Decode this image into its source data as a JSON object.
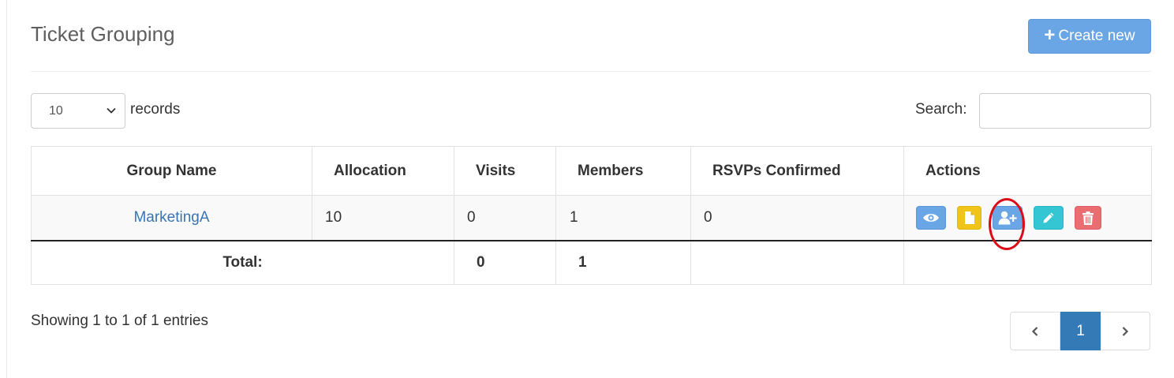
{
  "page": {
    "title": "Ticket Grouping"
  },
  "toolbar": {
    "create_label": "Create new",
    "create_icon": "plus-icon"
  },
  "length_menu": {
    "selected": "10",
    "suffix": "records"
  },
  "search": {
    "label": "Search:",
    "value": ""
  },
  "table": {
    "columns": [
      "Group Name",
      "Allocation",
      "Visits",
      "Members",
      "RSVPs Confirmed",
      "Actions"
    ],
    "rows": [
      {
        "group_name": "MarketingA",
        "allocation": "10",
        "visits": "0",
        "members": "1",
        "rsvps_confirmed": "0",
        "actions": [
          "eye-icon",
          "file-icon",
          "user-plus-icon",
          "pencil-icon",
          "trash-icon"
        ]
      }
    ],
    "footer": {
      "label": "Total:",
      "visits_total": "0",
      "members_total": "1"
    }
  },
  "info": {
    "text": "Showing 1 to 1 of 1 entries"
  },
  "pagination": {
    "prev": "‹",
    "current": "1",
    "next": "›"
  },
  "colors": {
    "primary": "#6aa6e6",
    "warning": "#f0c419",
    "info": "#34c6d3",
    "danger": "#ea6d72",
    "active_page": "#337ab7",
    "highlight_circle": "#dd0b16"
  }
}
